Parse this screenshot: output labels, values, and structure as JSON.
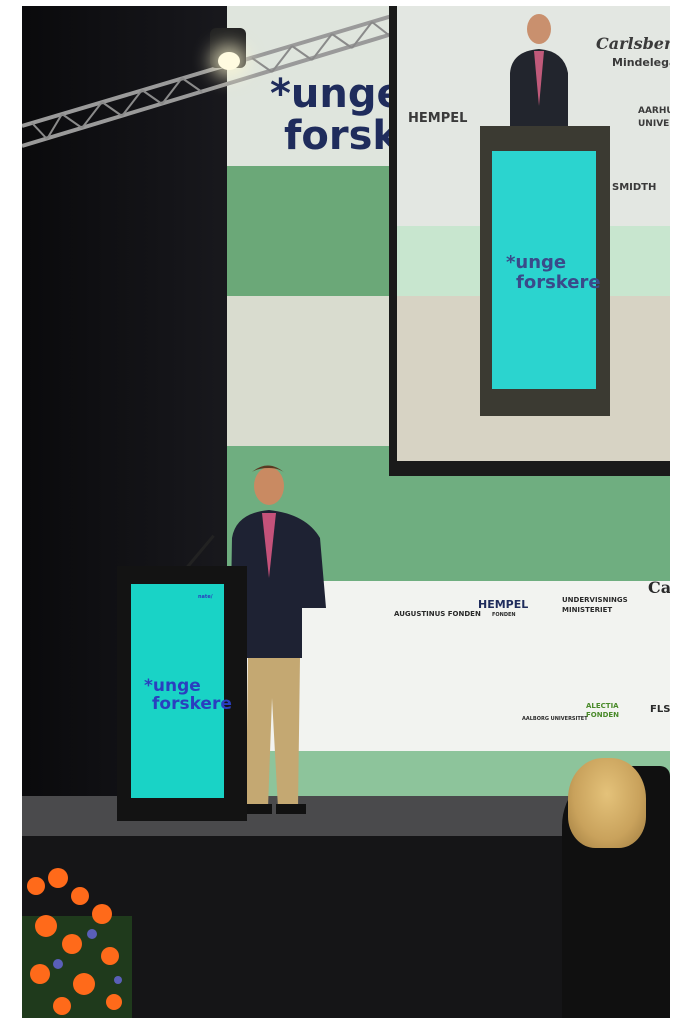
{
  "photo": {
    "brand_line1": "*unge",
    "brand_line2": "forskere"
  },
  "screen": {
    "brand_line1": "*unge",
    "brand_line2": "forskere",
    "sponsors": [
      "Carlsberg",
      "Mindelegat",
      "HEMPEL",
      "AARHUS",
      "UNIVERSITET",
      "SMIDTH"
    ]
  },
  "podium": {
    "tag": "nate/",
    "brand_line1": "*unge",
    "brand_line2": "forskere"
  },
  "sponsors": {
    "augustinus": "AUGUSTINUS FONDEN",
    "hempel": "HEMPEL",
    "hempel_sub": "FONDEN",
    "undervisning_1": "UNDERVISNINGS",
    "undervisning_2": "MINISTERIET",
    "carlsberg": "Car",
    "aalborg": "AALBORG UNIVERSITET",
    "alectia_1": "ALECTIA",
    "alectia_2": "FONDEN",
    "fls": "FLS"
  },
  "colors": {
    "podium_panel": "#19d3c6",
    "banner_green": "#6ba878",
    "brand_navy": "#1f2c5c",
    "stage": "#151517"
  }
}
